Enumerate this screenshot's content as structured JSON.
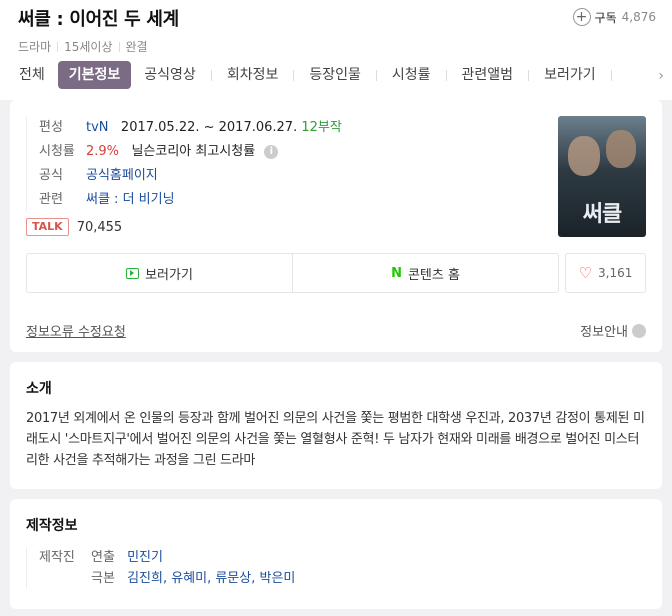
{
  "header": {
    "title": "써클 : 이어진 두 세계",
    "subscribe_label": "구독",
    "subscribe_count": "4,876",
    "meta": [
      "드라마",
      "15세이상",
      "완결"
    ],
    "tabs": [
      "전체",
      "기본정보",
      "공식영상",
      "회차정보",
      "등장인물",
      "시청률",
      "관련앨범",
      "보러가기",
      " "
    ],
    "active_tab_index": 1
  },
  "info": {
    "broadcast_label": "편성",
    "channel": "tvN",
    "period": "2017.05.22. ~ 2017.06.27.",
    "episodes": "12부작",
    "rating_label": "시청률",
    "rating_value": "2.9%",
    "rating_source": "닐슨코리아",
    "rating_type": "최고시청률",
    "official_label": "공식",
    "official_link": "공식홈페이지",
    "related_label": "관련",
    "related_link": "써클 : 더 비기닝",
    "talk_badge": "TALK",
    "talk_count": "70,455",
    "poster_title": "써클"
  },
  "actions": {
    "watch_label": "보러가기",
    "content_home_label": "콘텐츠 홈",
    "n_mark": "N",
    "like_count": "3,161"
  },
  "footer": {
    "report_label": "정보오류 수정요청",
    "guide_label": "정보안내"
  },
  "intro": {
    "title": "소개",
    "text": "2017년 외계에서 온 인물의 등장과 함께 벌어진 의문의 사건을 쫓는 평범한 대학생 우진과, 2037년 감정이 통제된 미래도시 '스마트지구'에서 벌어진 의문의 사건을 쫓는 열혈형사 준혁! 두 남자가 현재와 미래를 배경으로 벌어진 미스터리한 사건을 추적해가는 과정을 그린 드라마"
  },
  "production": {
    "title": "제작정보",
    "label": "제작진",
    "director_role": "연출",
    "director": "민진기",
    "writer_role": "극본",
    "writers": "김진희, 유혜미, 류문상, 박은미"
  },
  "colors": {
    "active_tab": "#7b6b84",
    "link": "#1a4d9e",
    "green": "#2e9d3a",
    "red": "#d6403a",
    "naver_green": "#1ec800"
  },
  "icons": [
    "plus-circle-icon",
    "chevron-right-icon",
    "info-icon",
    "play-icon",
    "naver-n-icon",
    "heart-icon"
  ]
}
